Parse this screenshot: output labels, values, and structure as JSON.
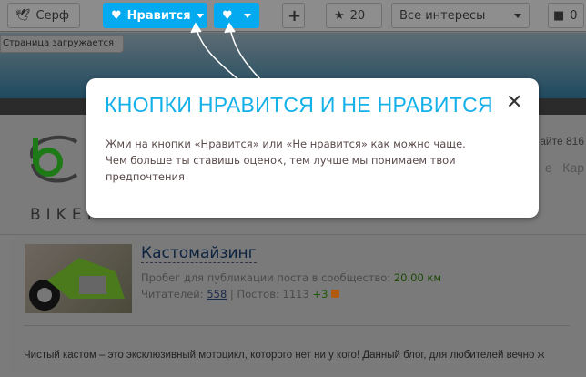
{
  "topbar": {
    "surf": "Серф",
    "like": "Нравится",
    "stars": "20",
    "interests": "Все интересы",
    "comments": "0"
  },
  "loading": "Страница загружается",
  "modal": {
    "title": "КНОПКИ НРАВИТСЯ И НЕ НРАВИТСЯ",
    "lines": [
      "Жми на кнопки «Нравится» или «Не нравится» как можно чаще.",
      "Чем больше ты ставишь оценок, тем лучше мы понимаем твои предпочтения"
    ]
  },
  "site": {
    "logo_text": "BIKEP",
    "header_right": "айте 816",
    "nav_partial": "е   Кар"
  },
  "community": {
    "title": "Кастомайзинг",
    "mileage_label": "Пробег для публикации поста в сообщество:",
    "mileage_value": "20.00 км",
    "readers_label": "Читателей:",
    "readers": "558",
    "posts_label": "| Постов: 1113",
    "posts_delta": "+3",
    "description": "Чистый кастом – это эксклюзивный мотоцикл, которого нет ни у кого! Данный блог, для любителей вечно ж"
  }
}
